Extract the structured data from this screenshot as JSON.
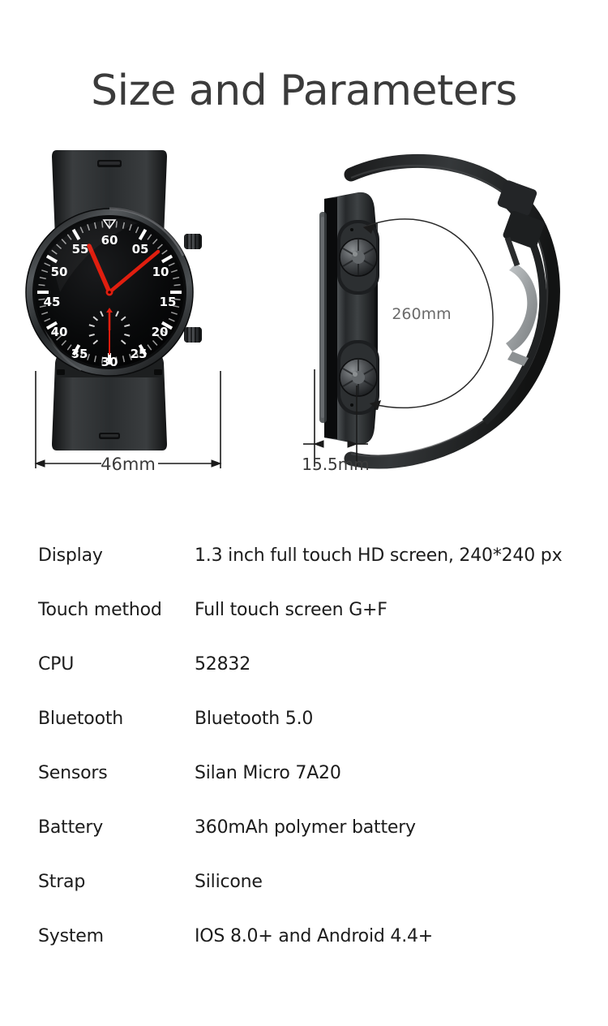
{
  "page": {
    "title": "Size and Parameters",
    "background_color": "#ffffff",
    "title_color": "#3b3b3b"
  },
  "illustration": {
    "front_view": {
      "name": "smartwatch-front-view",
      "dimension_label": "46mm",
      "watch_face": {
        "hour_markers": [
          "60",
          "05",
          "10",
          "15",
          "20",
          "25",
          "30",
          "35",
          "40",
          "45",
          "50",
          "55"
        ],
        "dial_color": "#0a0a0a",
        "hand_color": "#e01e0f",
        "marker_color": "#ffffff",
        "bezel_color": "#2a2c2e",
        "strap_color": "#262829"
      }
    },
    "side_view": {
      "name": "smartwatch-side-view",
      "thickness_label": "15.5mm",
      "strap_circumference_label": "260mm",
      "buckle_color": "#a8acae",
      "button_color": "#4a4d50"
    },
    "dimension_line_color": "#1a1a1a",
    "dimension_text_color": "#3a3a3a"
  },
  "specs": {
    "rows": [
      {
        "label": "Display",
        "value": "1.3 inch full touch HD screen, 240*240 px"
      },
      {
        "label": "Touch method",
        "value": "Full touch screen G+F"
      },
      {
        "label": "CPU",
        "value": "52832"
      },
      {
        "label": "Bluetooth",
        "value": "Bluetooth 5.0"
      },
      {
        "label": "Sensors",
        "value": "Silan Micro 7A20"
      },
      {
        "label": "Battery",
        "value": "360mAh polymer battery"
      },
      {
        "label": "Strap",
        "value": "Silicone"
      },
      {
        "label": "System",
        "value": "IOS 8.0+ and Android 4.4+"
      }
    ]
  }
}
